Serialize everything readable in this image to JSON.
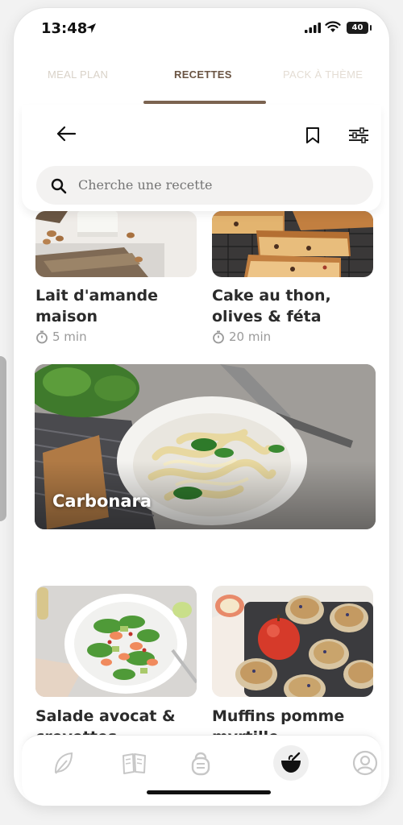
{
  "status_bar": {
    "time": "13:48",
    "battery": "40"
  },
  "tabs": [
    {
      "label": "MEAL PLAN",
      "active": false
    },
    {
      "label": "RECETTES",
      "active": true
    },
    {
      "label": "PACK À THÈME",
      "active": false
    }
  ],
  "search": {
    "placeholder": "Cherche une recette"
  },
  "recipes": [
    {
      "title_line1": "Lait d'amande",
      "title_line2": "maison",
      "time": "5 min"
    },
    {
      "title_line1": "Cake au thon,",
      "title_line2": "olives & féta",
      "time": "20 min"
    },
    {
      "title": "Carbonara"
    },
    {
      "title_line1": "Salade avocat &",
      "title_line2": "crevettes"
    },
    {
      "title_line1": "Muffins pomme",
      "title_line2": "myrtille"
    }
  ],
  "bottom_nav": [
    {
      "icon": "leaf-icon",
      "active": false
    },
    {
      "icon": "book-icon",
      "active": false
    },
    {
      "icon": "kettlebell-icon",
      "active": false
    },
    {
      "icon": "bowl-icon",
      "active": true
    },
    {
      "icon": "profile-icon",
      "active": false
    }
  ],
  "colors": {
    "accent": "#7b6350",
    "inactive_tab": "#d9d2c8",
    "text": "#2b2b2b",
    "muted": "#9a9a9a"
  }
}
